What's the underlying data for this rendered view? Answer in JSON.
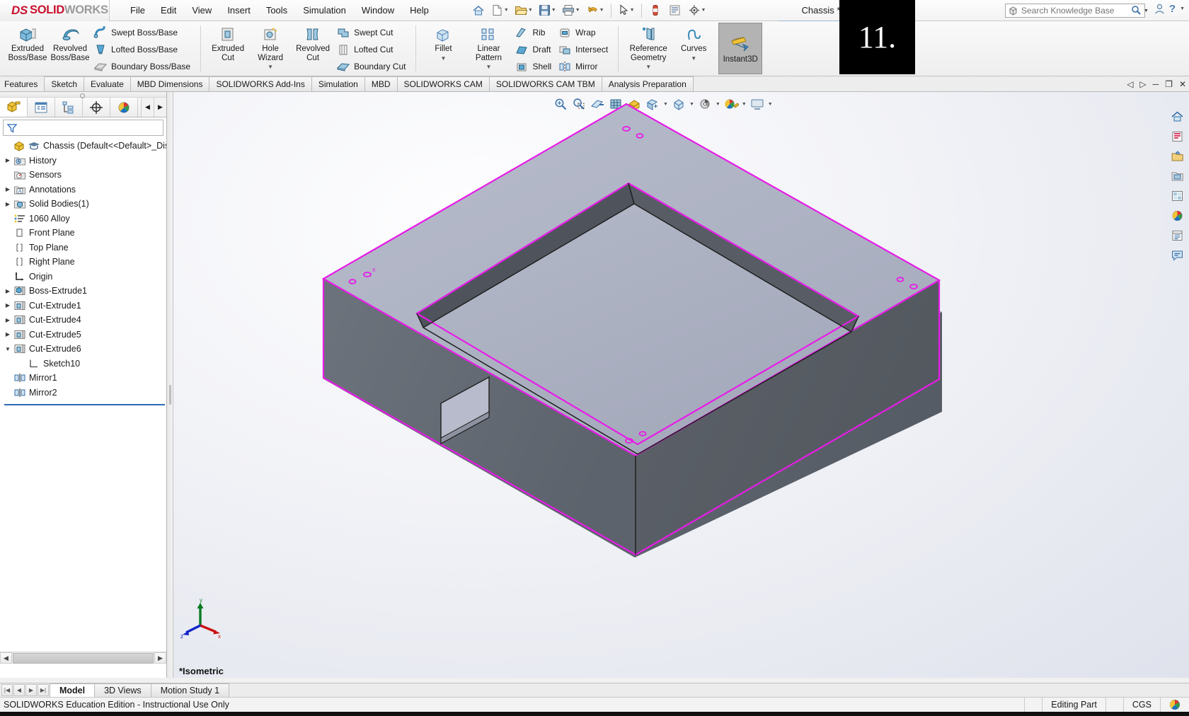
{
  "app": {
    "brand_ds": "DS",
    "brand_bold": "SOLID",
    "brand_light": "WORKS",
    "document_title": "Chassis *",
    "overlay_badge": "11."
  },
  "menu": {
    "items": [
      "File",
      "Edit",
      "View",
      "Insert",
      "Tools",
      "Simulation",
      "Window",
      "Help"
    ]
  },
  "search": {
    "placeholder": "Search Knowledge Base",
    "value": ""
  },
  "ribbon": {
    "groups": [
      {
        "name": "features-primary",
        "big_buttons": [
          {
            "label_line1": "Extruded",
            "label_line2": "Boss/Base",
            "icon": "extruded-boss-icon"
          },
          {
            "label_line1": "Revolved",
            "label_line2": "Boss/Base",
            "icon": "revolved-boss-icon"
          }
        ],
        "small_buttons": [
          {
            "label": "Swept Boss/Base",
            "icon": "swept-boss-icon"
          },
          {
            "label": "Lofted Boss/Base",
            "icon": "lofted-boss-icon"
          },
          {
            "label": "Boundary Boss/Base",
            "icon": "boundary-boss-icon"
          }
        ]
      },
      {
        "name": "cut",
        "big_buttons": [
          {
            "label_line1": "Extruded",
            "label_line2": "Cut",
            "icon": "extruded-cut-icon"
          },
          {
            "label_line1": "Hole",
            "label_line2": "Wizard",
            "icon": "hole-wizard-icon",
            "has_dropdown": true
          },
          {
            "label_line1": "Revolved",
            "label_line2": "Cut",
            "icon": "revolved-cut-icon"
          }
        ],
        "small_buttons": [
          {
            "label": "Swept Cut",
            "icon": "swept-cut-icon"
          },
          {
            "label": "Lofted Cut",
            "icon": "lofted-cut-icon"
          },
          {
            "label": "Boundary Cut",
            "icon": "boundary-cut-icon"
          }
        ]
      },
      {
        "name": "modify",
        "big_buttons": [
          {
            "label_line1": "Fillet",
            "label_line2": "",
            "icon": "fillet-icon",
            "has_dropdown": true
          },
          {
            "label_line1": "Linear",
            "label_line2": "Pattern",
            "icon": "linear-pattern-icon",
            "has_dropdown": true
          }
        ],
        "small_buttons": [
          {
            "label": "Rib",
            "icon": "rib-icon"
          },
          {
            "label": "Draft",
            "icon": "draft-icon"
          },
          {
            "label": "Shell",
            "icon": "shell-icon"
          }
        ],
        "small_buttons2": [
          {
            "label": "Wrap",
            "icon": "wrap-icon"
          },
          {
            "label": "Intersect",
            "icon": "intersect-icon"
          },
          {
            "label": "Mirror",
            "icon": "mirror-icon"
          }
        ]
      },
      {
        "name": "reference",
        "big_buttons": [
          {
            "label_line1": "Reference",
            "label_line2": "Geometry",
            "icon": "reference-geometry-icon",
            "has_dropdown": true
          },
          {
            "label_line1": "Curves",
            "label_line2": "",
            "icon": "curves-icon",
            "has_dropdown": true
          }
        ]
      }
    ],
    "instant3d": {
      "label": "Instant3D",
      "active": true
    }
  },
  "command_tabs": {
    "items": [
      {
        "label": "Features",
        "active": true,
        "plain": true
      },
      {
        "label": "Sketch",
        "active": false
      },
      {
        "label": "Evaluate",
        "active": false
      },
      {
        "label": "MBD Dimensions",
        "active": false
      },
      {
        "label": "SOLIDWORKS Add-Ins",
        "active": false
      },
      {
        "label": "Simulation",
        "active": false
      },
      {
        "label": "MBD",
        "active": false
      },
      {
        "label": "SOLIDWORKS CAM",
        "active": false
      },
      {
        "label": "SOLIDWORKS CAM TBM",
        "active": false
      },
      {
        "label": "Analysis Preparation",
        "active": false
      }
    ]
  },
  "feature_manager": {
    "tabs": [
      {
        "name": "feature-tree-tab",
        "active": true
      },
      {
        "name": "property-manager-tab",
        "active": false
      },
      {
        "name": "configuration-manager-tab",
        "active": false
      },
      {
        "name": "dimxpert-manager-tab",
        "active": false
      },
      {
        "name": "display-manager-tab",
        "active": false
      }
    ],
    "filter_placeholder": "",
    "tree": [
      {
        "label": "Chassis  (Default<<Default>_Displa",
        "icon": "part-icon",
        "indent": 0,
        "arrow": "",
        "root": true
      },
      {
        "label": "History",
        "icon": "history-icon",
        "indent": 1,
        "arrow": "collapsed"
      },
      {
        "label": "Sensors",
        "icon": "sensors-icon",
        "indent": 1,
        "arrow": ""
      },
      {
        "label": "Annotations",
        "icon": "annotations-icon",
        "indent": 1,
        "arrow": "collapsed"
      },
      {
        "label": "Solid Bodies(1)",
        "icon": "solid-bodies-icon",
        "indent": 1,
        "arrow": "collapsed"
      },
      {
        "label": "1060 Alloy",
        "icon": "material-icon",
        "indent": 1,
        "arrow": ""
      },
      {
        "label": "Front Plane",
        "icon": "plane-icon",
        "indent": 1,
        "arrow": ""
      },
      {
        "label": "Top Plane",
        "icon": "plane-icon",
        "indent": 1,
        "arrow": ""
      },
      {
        "label": "Right Plane",
        "icon": "plane-icon",
        "indent": 1,
        "arrow": ""
      },
      {
        "label": "Origin",
        "icon": "origin-icon",
        "indent": 1,
        "arrow": ""
      },
      {
        "label": "Boss-Extrude1",
        "icon": "boss-extrude-icon",
        "indent": 1,
        "arrow": "collapsed"
      },
      {
        "label": "Cut-Extrude1",
        "icon": "cut-extrude-icon",
        "indent": 1,
        "arrow": "collapsed"
      },
      {
        "label": "Cut-Extrude4",
        "icon": "cut-extrude-icon",
        "indent": 1,
        "arrow": "collapsed"
      },
      {
        "label": "Cut-Extrude5",
        "icon": "cut-extrude-icon",
        "indent": 1,
        "arrow": "collapsed"
      },
      {
        "label": "Cut-Extrude6",
        "icon": "cut-extrude-icon",
        "indent": 1,
        "arrow": "expanded"
      },
      {
        "label": "Sketch10",
        "icon": "sketch-icon",
        "indent": 2,
        "arrow": ""
      },
      {
        "label": "Mirror1",
        "icon": "mirror-feature-icon",
        "indent": 1,
        "arrow": ""
      },
      {
        "label": "Mirror2",
        "icon": "mirror-feature-icon",
        "indent": 1,
        "arrow": ""
      }
    ]
  },
  "view_toolbar": {
    "buttons": [
      {
        "name": "zoom-to-fit-icon"
      },
      {
        "name": "zoom-to-area-icon"
      },
      {
        "name": "section-view-icon"
      },
      {
        "name": "view-orientation-icon"
      },
      {
        "name": "display-style-icon"
      },
      {
        "name": "hide-show-items-icon",
        "has_caret": true
      },
      {
        "name": "edit-appearance-icon",
        "has_caret": true
      },
      {
        "name": "apply-scene-icon",
        "has_caret": true
      },
      {
        "name": "view-settings-icon",
        "has_caret": true
      },
      {
        "name": "viewport-icon",
        "has_caret": true
      }
    ]
  },
  "right_toolbar": {
    "buttons": [
      {
        "name": "home-icon"
      },
      {
        "name": "solidworks-resources-icon"
      },
      {
        "name": "design-library-icon"
      },
      {
        "name": "file-explorer-icon"
      },
      {
        "name": "view-palette-icon"
      },
      {
        "name": "appearances-scenes-icon"
      },
      {
        "name": "custom-properties-icon"
      },
      {
        "name": "solidworks-forum-icon"
      }
    ]
  },
  "graphics": {
    "view_label": "*Isometric",
    "triad": {
      "x": "x",
      "y": "y",
      "z": "z"
    },
    "colors": {
      "face_top": "#aeb2c4",
      "face_side": "#646a72",
      "edge_highlight": "#e81be8",
      "edge_normal": "#2b2b2b"
    }
  },
  "bottom_tabs": {
    "items": [
      {
        "label": "Model",
        "active": true
      },
      {
        "label": "3D Views",
        "active": false
      },
      {
        "label": "Motion Study 1",
        "active": false
      }
    ]
  },
  "status_bar": {
    "left": "SOLIDWORKS Education Edition - Instructional Use Only",
    "editing": "Editing Part",
    "units": "CGS"
  },
  "window_controls": {
    "restore_panel_left": "◁",
    "restore_panel_right": "▷",
    "minimize": "─",
    "maximize": "❐",
    "close": "✕"
  }
}
